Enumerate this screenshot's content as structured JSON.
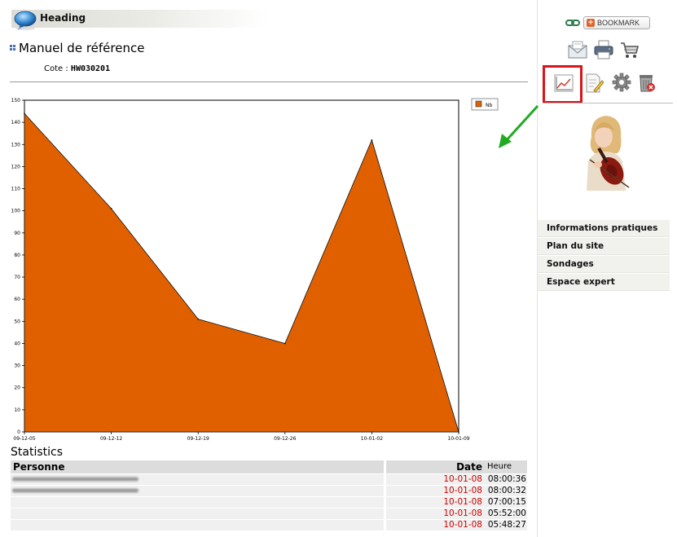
{
  "header": {
    "heading": "Heading",
    "page_title": "Manuel de référence",
    "cote_label": "Cote :",
    "cote_value": "HW030201"
  },
  "sidebar": {
    "bookmark_label": "BOOKMARK",
    "icons": [
      "email-icon",
      "print-icon",
      "cart-icon",
      "chart-icon",
      "edit-document-icon",
      "gear-icon",
      "trash-icon"
    ],
    "menu": [
      "Informations pratiques",
      "Plan du site",
      "Sondages",
      "Espace expert"
    ]
  },
  "statistics": {
    "title": "Statistics",
    "col_person": "Personne",
    "col_date": "Date",
    "col_time": "Heure",
    "rows": [
      {
        "date": "10-01-08",
        "time": "08:00:36"
      },
      {
        "date": "10-01-08",
        "time": "08:00:32"
      },
      {
        "date": "10-01-08",
        "time": "07:00:15"
      },
      {
        "date": "10-01-08",
        "time": "05:52:00"
      },
      {
        "date": "10-01-08",
        "time": "05:48:27"
      }
    ]
  },
  "colors": {
    "area_fill": "#e06000",
    "highlight": "#d9141c",
    "arrow": "#22aa22",
    "date_text": "#cc0000"
  },
  "chart_data": {
    "type": "area",
    "x": [
      "09-12-05",
      "09-12-12",
      "09-12-19",
      "09-12-26",
      "10-01-02",
      "10-01-09"
    ],
    "series": [
      {
        "name": "Nb",
        "values": [
          144,
          101,
          51,
          40,
          132,
          0
        ]
      }
    ],
    "ylim": [
      0,
      150
    ],
    "yticks": [
      0,
      10,
      20,
      30,
      40,
      50,
      60,
      70,
      80,
      90,
      100,
      110,
      120,
      130,
      140,
      150
    ],
    "legend": "top-right",
    "grid": false
  }
}
